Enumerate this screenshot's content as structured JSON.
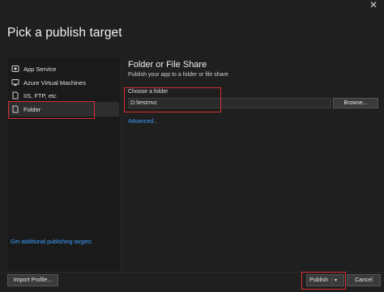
{
  "dialog": {
    "close_glyph": "✕",
    "title": "Pick a publish target"
  },
  "sidebar": {
    "items": [
      {
        "label": "App Service",
        "icon": "app-service-icon"
      },
      {
        "label": "Azure Virtual Machines",
        "icon": "virtual-machine-icon"
      },
      {
        "label": "IIS, FTP, etc",
        "icon": "iis-ftp-icon"
      },
      {
        "label": "Folder",
        "icon": "folder-icon",
        "selected": true
      }
    ],
    "more_link": "Get additional publishing targets"
  },
  "main": {
    "heading": "Folder or File Share",
    "subheading": "Publish your app to a folder or file share",
    "choose_label": "Choose a folder",
    "folder_value": "D:\\testmvc",
    "browse_label": "Browse...",
    "advanced_link": "Advanced..."
  },
  "footer": {
    "import_label": "Import Profile...",
    "publish_label": "Publish",
    "publish_caret": "▾",
    "cancel_label": "Cancel"
  },
  "colors": {
    "background": "#1f1f1f",
    "link": "#3aa0ff",
    "highlight_box": "#d32f2f"
  }
}
